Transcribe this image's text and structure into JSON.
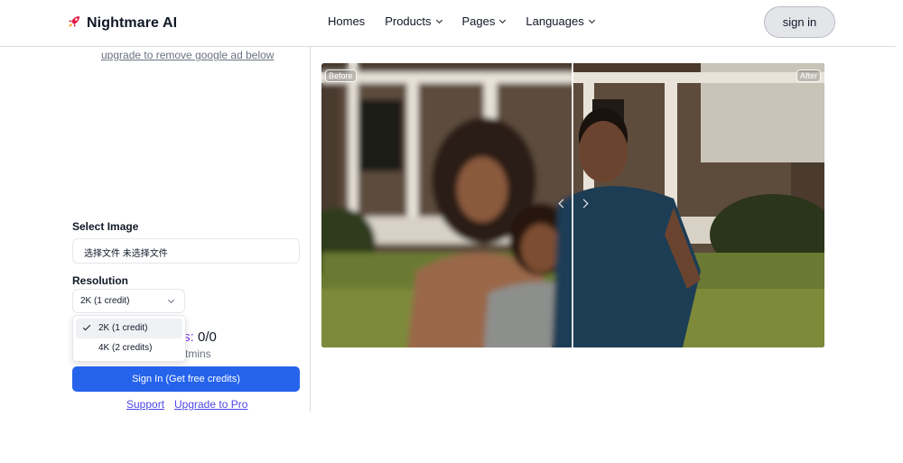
{
  "header": {
    "brand_name": "Nightmare AI",
    "brand_icon": "rocket-icon",
    "nav": {
      "home": "Homes",
      "products": "Products",
      "pages": "Pages",
      "languages": "Languages"
    },
    "signin_label": "sign in"
  },
  "left_panel": {
    "ad_link": "upgrade to remove google ad below",
    "select_image_label": "Select Image",
    "file_input_text": "选择文件  未选择文件",
    "resolution_label": "Resolution",
    "resolution_selected": "2K (1 credit)",
    "resolution_options": [
      "2K (1 credit)",
      "4K (2 credits)"
    ],
    "credits_partial": "ts:",
    "credits_value": "0/0",
    "mins_partial": "tmins",
    "primary_button": "Sign In (Get free credits)",
    "support_link": "Support",
    "upgrade_link": "Upgrade to Pro"
  },
  "comparison": {
    "before_label": "Before",
    "after_label": "After"
  },
  "colors": {
    "primary": "#2563eb",
    "link": "#4f46e5",
    "accent_purple": "#7c3aed"
  }
}
